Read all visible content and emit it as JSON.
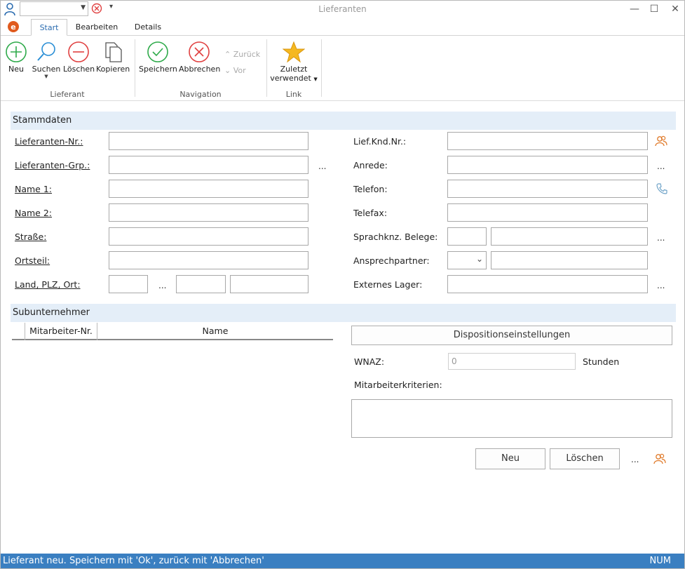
{
  "window": {
    "title": "Lieferanten"
  },
  "tabs": [
    "Start",
    "Bearbeiten",
    "Details"
  ],
  "ribbon": {
    "lieferant": {
      "label": "Lieferant",
      "neu": "Neu",
      "suchen": "Suchen",
      "loeschen": "Löschen",
      "kopieren": "Kopieren"
    },
    "navigation": {
      "label": "Navigation",
      "speichern": "Speichern",
      "abbrechen": "Abbrechen",
      "zurueck": "Zurück",
      "vor": "Vor"
    },
    "link": {
      "label": "Link",
      "zuletzt_line1": "Zuletzt",
      "zuletzt_line2": "verwendet"
    }
  },
  "stammdaten": {
    "title": "Stammdaten",
    "left": {
      "lieferanten_nr": "Lieferanten-Nr.:",
      "lieferanten_grp": "Lieferanten-Grp.:",
      "name1": "Name 1:",
      "name2": "Name 2:",
      "strasse": "Straße:",
      "ortsteil": "Ortsteil:",
      "land_plz_ort": "Land, PLZ, Ort:"
    },
    "right": {
      "lief_knd_nr": "Lief.Knd.Nr.:",
      "anrede": "Anrede:",
      "telefon": "Telefon:",
      "telefax": "Telefax:",
      "sprachknz": "Sprachknz. Belege:",
      "ansprechpartner": "Ansprechpartner:",
      "externes_lager": "Externes Lager:"
    },
    "ellipsis": "..."
  },
  "subunternehmer": {
    "title": "Subunternehmer",
    "columns": [
      "Mitarbeiter-Nr.",
      "Name"
    ],
    "dispositions_button": "Dispositionseinstellungen",
    "wnaz_label": "WNAZ:",
    "wnaz_value": "0",
    "stunden_label": "Stunden",
    "mitarbeiterkriterien_label": "Mitarbeiterkriterien:",
    "neu_button": "Neu",
    "loeschen_button": "Löschen",
    "ellipsis": "..."
  },
  "status": {
    "message": "Lieferant neu. Speichern mit 'Ok', zurück mit 'Abbrechen'",
    "num": "NUM"
  },
  "colors": {
    "accent_blue": "#3a7fc1",
    "section_bg": "#e4eef8",
    "green": "#2eaa4a",
    "red": "#e04040",
    "orange": "#e07a2a",
    "star": "#f5b820"
  }
}
